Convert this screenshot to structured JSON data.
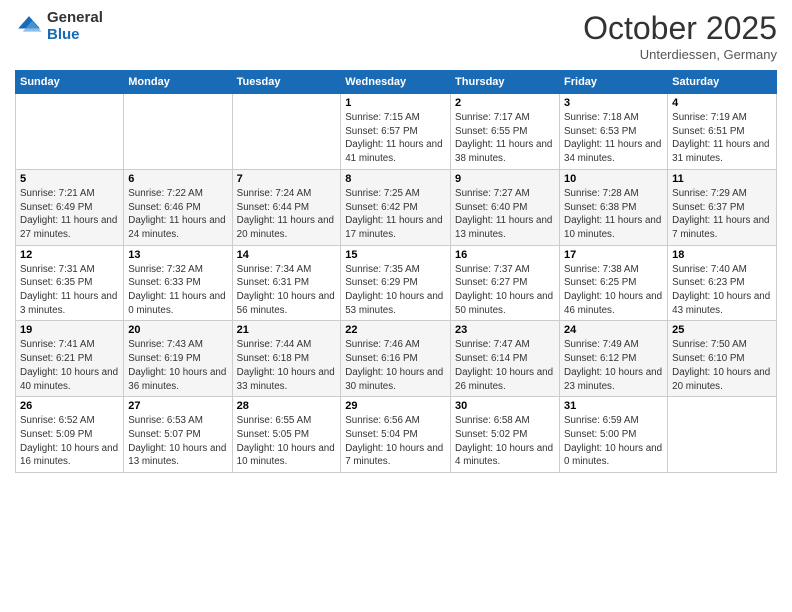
{
  "logo": {
    "general": "General",
    "blue": "Blue"
  },
  "header": {
    "month": "October 2025",
    "location": "Unterdiessen, Germany"
  },
  "days_of_week": [
    "Sunday",
    "Monday",
    "Tuesday",
    "Wednesday",
    "Thursday",
    "Friday",
    "Saturday"
  ],
  "weeks": [
    [
      {
        "day": "",
        "info": ""
      },
      {
        "day": "",
        "info": ""
      },
      {
        "day": "",
        "info": ""
      },
      {
        "day": "1",
        "info": "Sunrise: 7:15 AM\nSunset: 6:57 PM\nDaylight: 11 hours and 41 minutes."
      },
      {
        "day": "2",
        "info": "Sunrise: 7:17 AM\nSunset: 6:55 PM\nDaylight: 11 hours and 38 minutes."
      },
      {
        "day": "3",
        "info": "Sunrise: 7:18 AM\nSunset: 6:53 PM\nDaylight: 11 hours and 34 minutes."
      },
      {
        "day": "4",
        "info": "Sunrise: 7:19 AM\nSunset: 6:51 PM\nDaylight: 11 hours and 31 minutes."
      }
    ],
    [
      {
        "day": "5",
        "info": "Sunrise: 7:21 AM\nSunset: 6:49 PM\nDaylight: 11 hours and 27 minutes."
      },
      {
        "day": "6",
        "info": "Sunrise: 7:22 AM\nSunset: 6:46 PM\nDaylight: 11 hours and 24 minutes."
      },
      {
        "day": "7",
        "info": "Sunrise: 7:24 AM\nSunset: 6:44 PM\nDaylight: 11 hours and 20 minutes."
      },
      {
        "day": "8",
        "info": "Sunrise: 7:25 AM\nSunset: 6:42 PM\nDaylight: 11 hours and 17 minutes."
      },
      {
        "day": "9",
        "info": "Sunrise: 7:27 AM\nSunset: 6:40 PM\nDaylight: 11 hours and 13 minutes."
      },
      {
        "day": "10",
        "info": "Sunrise: 7:28 AM\nSunset: 6:38 PM\nDaylight: 11 hours and 10 minutes."
      },
      {
        "day": "11",
        "info": "Sunrise: 7:29 AM\nSunset: 6:37 PM\nDaylight: 11 hours and 7 minutes."
      }
    ],
    [
      {
        "day": "12",
        "info": "Sunrise: 7:31 AM\nSunset: 6:35 PM\nDaylight: 11 hours and 3 minutes."
      },
      {
        "day": "13",
        "info": "Sunrise: 7:32 AM\nSunset: 6:33 PM\nDaylight: 11 hours and 0 minutes."
      },
      {
        "day": "14",
        "info": "Sunrise: 7:34 AM\nSunset: 6:31 PM\nDaylight: 10 hours and 56 minutes."
      },
      {
        "day": "15",
        "info": "Sunrise: 7:35 AM\nSunset: 6:29 PM\nDaylight: 10 hours and 53 minutes."
      },
      {
        "day": "16",
        "info": "Sunrise: 7:37 AM\nSunset: 6:27 PM\nDaylight: 10 hours and 50 minutes."
      },
      {
        "day": "17",
        "info": "Sunrise: 7:38 AM\nSunset: 6:25 PM\nDaylight: 10 hours and 46 minutes."
      },
      {
        "day": "18",
        "info": "Sunrise: 7:40 AM\nSunset: 6:23 PM\nDaylight: 10 hours and 43 minutes."
      }
    ],
    [
      {
        "day": "19",
        "info": "Sunrise: 7:41 AM\nSunset: 6:21 PM\nDaylight: 10 hours and 40 minutes."
      },
      {
        "day": "20",
        "info": "Sunrise: 7:43 AM\nSunset: 6:19 PM\nDaylight: 10 hours and 36 minutes."
      },
      {
        "day": "21",
        "info": "Sunrise: 7:44 AM\nSunset: 6:18 PM\nDaylight: 10 hours and 33 minutes."
      },
      {
        "day": "22",
        "info": "Sunrise: 7:46 AM\nSunset: 6:16 PM\nDaylight: 10 hours and 30 minutes."
      },
      {
        "day": "23",
        "info": "Sunrise: 7:47 AM\nSunset: 6:14 PM\nDaylight: 10 hours and 26 minutes."
      },
      {
        "day": "24",
        "info": "Sunrise: 7:49 AM\nSunset: 6:12 PM\nDaylight: 10 hours and 23 minutes."
      },
      {
        "day": "25",
        "info": "Sunrise: 7:50 AM\nSunset: 6:10 PM\nDaylight: 10 hours and 20 minutes."
      }
    ],
    [
      {
        "day": "26",
        "info": "Sunrise: 6:52 AM\nSunset: 5:09 PM\nDaylight: 10 hours and 16 minutes."
      },
      {
        "day": "27",
        "info": "Sunrise: 6:53 AM\nSunset: 5:07 PM\nDaylight: 10 hours and 13 minutes."
      },
      {
        "day": "28",
        "info": "Sunrise: 6:55 AM\nSunset: 5:05 PM\nDaylight: 10 hours and 10 minutes."
      },
      {
        "day": "29",
        "info": "Sunrise: 6:56 AM\nSunset: 5:04 PM\nDaylight: 10 hours and 7 minutes."
      },
      {
        "day": "30",
        "info": "Sunrise: 6:58 AM\nSunset: 5:02 PM\nDaylight: 10 hours and 4 minutes."
      },
      {
        "day": "31",
        "info": "Sunrise: 6:59 AM\nSunset: 5:00 PM\nDaylight: 10 hours and 0 minutes."
      },
      {
        "day": "",
        "info": ""
      }
    ]
  ]
}
